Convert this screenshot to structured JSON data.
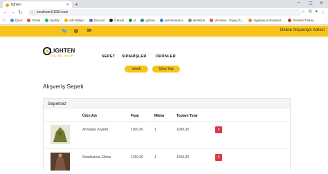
{
  "browser": {
    "tab_title": "lighten",
    "new_tab": "+",
    "url": "localhost:61061/cart",
    "window_controls": [
      "–",
      "▢",
      "✕"
    ]
  },
  "bookmarks": [
    {
      "label": "Çevir",
      "color": "#4285f4"
    },
    {
      "label": "Gmail",
      "color": "#ea4335"
    },
    {
      "label": "Spotify",
      "color": "#1db954"
    },
    {
      "label": "Adlı Bilişim",
      "color": "#f4b400"
    },
    {
      "label": "Discord",
      "color": "#5865f2"
    },
    {
      "label": "GitHub",
      "color": "#222222"
    },
    {
      "label": "xl",
      "color": "#0f9d58"
    },
    {
      "label": "python",
      "color": "#3776ab"
    },
    {
      "label": "kali simulacui",
      "color": "#367bf0"
    },
    {
      "label": "seslisme",
      "color": "#888888"
    },
    {
      "label": "Voxceen - Dying Gi...",
      "color": "#d9534f"
    },
    {
      "label": "Ingesasus Backend...",
      "color": "#e67e22"
    },
    {
      "label": "Pentest Turkey",
      "color": "#c0392b"
    }
  ],
  "topstrip": {
    "social_icons": [
      "twitter-icon",
      "instagram-icon",
      "linkedin-icon"
    ],
    "social_glyphs": [
      "🐦",
      "◎",
      "in"
    ],
    "address_link": "Online Alışverişin Adresi"
  },
  "logo": {
    "brand": "LIGHTEN",
    "tagline": "ONLINE SHOP"
  },
  "nav": {
    "items": [
      "SEPET",
      "SİPARİŞLER",
      "ÜRÜNLER"
    ],
    "user_button": "ornek",
    "logout_button": "Çıkış Yap"
  },
  "page_title": "Alışveriş Sepeti",
  "cart": {
    "header": "Sepetiniz",
    "columns": [
      "Ürün Adı",
      "Fiyat",
      "Miktar",
      "Toplam Tutar"
    ],
    "rows": [
      {
        "name": "Armağan Kiyafet",
        "price": "1000,00",
        "qty": "1",
        "total": "1000,00",
        "delete": "X",
        "thumb_color": "#6e7b2f"
      },
      {
        "name": "Stradivarius Elbise",
        "price": "1250,00",
        "qty": "1",
        "total": "1250,00",
        "delete": "X",
        "thumb_color": "#6b4a35"
      }
    ]
  },
  "colors": {
    "accent": "#f7c31a",
    "delete": "#dc3545"
  }
}
